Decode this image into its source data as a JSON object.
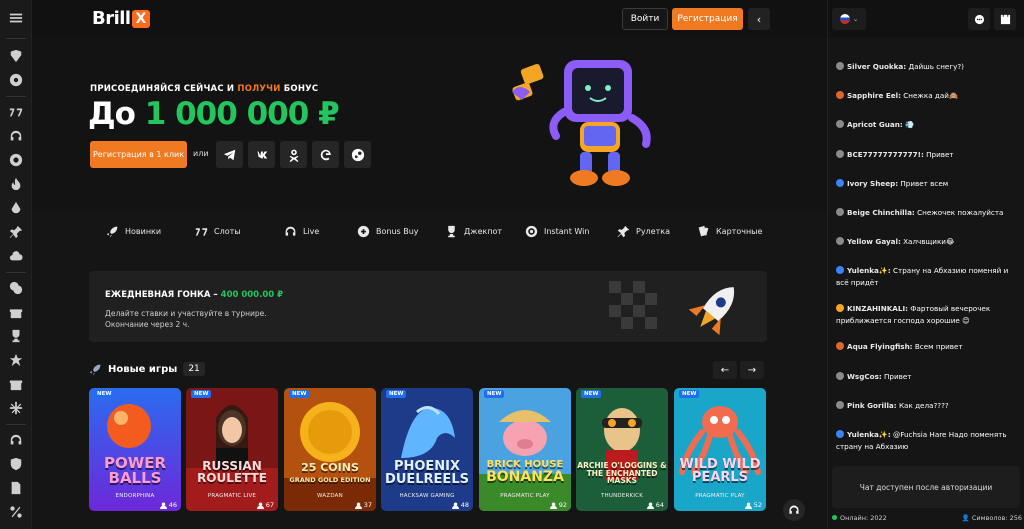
{
  "brand": {
    "logo_text": "Brill",
    "logo_mark": "X",
    "accent": "#f07a22",
    "green": "#22c55e"
  },
  "header": {
    "login_label": "Войти",
    "register_label": "Регистрация",
    "collapse_icon": "chevron-left-icon"
  },
  "rail": {
    "icons": [
      "sports-icon",
      "soccer-icon",
      "slots-icon",
      "headset-icon",
      "target-icon",
      "fire-icon",
      "drop-icon",
      "pin-icon",
      "cloud-icon",
      "coins-icon",
      "gift-icon",
      "trophy-icon",
      "star-icon",
      "present-icon",
      "snowflake-icon",
      "support-icon",
      "shield-icon",
      "document-icon",
      "percent-icon"
    ]
  },
  "hero": {
    "kicker_1": "ПРИСОЕДИНЯЙСЯ СЕЙЧАС И",
    "kicker_2": "ПОЛУЧИ",
    "kicker_3": "БОНУС",
    "amount_prefix": "До",
    "amount_value": "1 000 000 ₽",
    "cta_label": "Регистрация в 1 клик",
    "or_label": "или",
    "socials": [
      "telegram-icon",
      "vk-icon",
      "ok-icon",
      "google-icon",
      "steam-icon"
    ]
  },
  "categories": [
    {
      "label": "Новинки",
      "icon": "rocket-icon"
    },
    {
      "label": "Слоты",
      "icon": "slots-icon"
    },
    {
      "label": "Live",
      "icon": "headset-icon"
    },
    {
      "label": "Bonus Buy",
      "icon": "bonus-icon"
    },
    {
      "label": "Джекпот",
      "icon": "trophy-icon"
    },
    {
      "label": "Instant Win",
      "icon": "instant-icon"
    },
    {
      "label": "Рулетка",
      "icon": "roulette-icon"
    },
    {
      "label": "Карточные",
      "icon": "cards-icon"
    }
  ],
  "race": {
    "title": "ЕЖЕДНЕВНАЯ ГОНКА –",
    "prize": "400 000.00 ₽",
    "description": "Делайте ставки и участвуйте в турнире.",
    "ends": "Окончание через 2 ч."
  },
  "new_games": {
    "title": "Новые игры",
    "count": "21",
    "prev": "←",
    "next": "→",
    "badge": "NEW",
    "items": [
      {
        "title_1": "POWER",
        "title_2": "BALLS",
        "provider": "ENDORPHINA",
        "players": "46"
      },
      {
        "title_1": "RUSSIAN",
        "title_2": "ROULETTE",
        "provider": "PRAGMATIC LIVE",
        "players": "67"
      },
      {
        "title_1": "25 COINS",
        "title_2": "GRAND GOLD EDITION",
        "provider": "WAZDAN",
        "players": "37"
      },
      {
        "title_1": "PHOENIX",
        "title_2": "DUELREELS",
        "provider": "HACKSAW GAMING",
        "players": "48"
      },
      {
        "title_1": "BRICK HOUSE",
        "title_2": "BONANZA",
        "provider": "PRAGMATIC PLAY",
        "players": "92"
      },
      {
        "title_1": "ARCHIE O'LOGGINS &",
        "title_2": "THE ENCHANTED MASKS",
        "provider": "THUNDERKICK",
        "players": "64"
      },
      {
        "title_1": "WILD WILD",
        "title_2": "PEARLS",
        "provider": "PRAGMATIC PLAY",
        "players": "52"
      }
    ]
  },
  "chat": {
    "messages": [
      {
        "name": "Silver Quokka:",
        "text": "Дайшь снегу?)",
        "color": "#8a8a8a"
      },
      {
        "name": "Sapphire Eel:",
        "text": "Снежка дай🙈",
        "color": "#e0652a"
      },
      {
        "name": "Apricot Guan:",
        "text": "💨",
        "color": "#8a8a8a"
      },
      {
        "name": "ВСЕ77777777777!:",
        "text": "Привет",
        "color": "#8a8a8a"
      },
      {
        "name": "Ivory Sheep:",
        "text": "Привет всем",
        "color": "#3b82f6"
      },
      {
        "name": "Beige Chinchilla:",
        "text": "Снежочек пожалуйста",
        "color": "#8a8a8a"
      },
      {
        "name": "Yellow Gayal:",
        "text": "Халчвщики😂",
        "color": "#8a8a8a"
      },
      {
        "name": "Yulenka✨:",
        "text": "Страну на Абхазию поменяй и всё придёт",
        "color": "#3b82f6"
      },
      {
        "name": "KINZAHINKALI:",
        "text": "Фартовый вечерочек приближается господа хорошие 😊",
        "color": "#f5a524"
      },
      {
        "name": "Aqua Flyingfish:",
        "text": "Всем привет",
        "color": "#e0652a"
      },
      {
        "name": "WsgCos:",
        "text": "Привет",
        "color": "#8a8a8a"
      },
      {
        "name": "Pink Gorilla:",
        "text": "Как дела????",
        "color": "#8a8a8a"
      },
      {
        "name": "Yulenka✨:",
        "text": "@Fuchsia Hare  Надо поменять страну на Абхазию",
        "color": "#3b82f6"
      }
    ],
    "auth_notice": "Чат доступен после авторизации",
    "online_label": "Онлайн: 2022",
    "symbols_label": "Символов: 256"
  }
}
